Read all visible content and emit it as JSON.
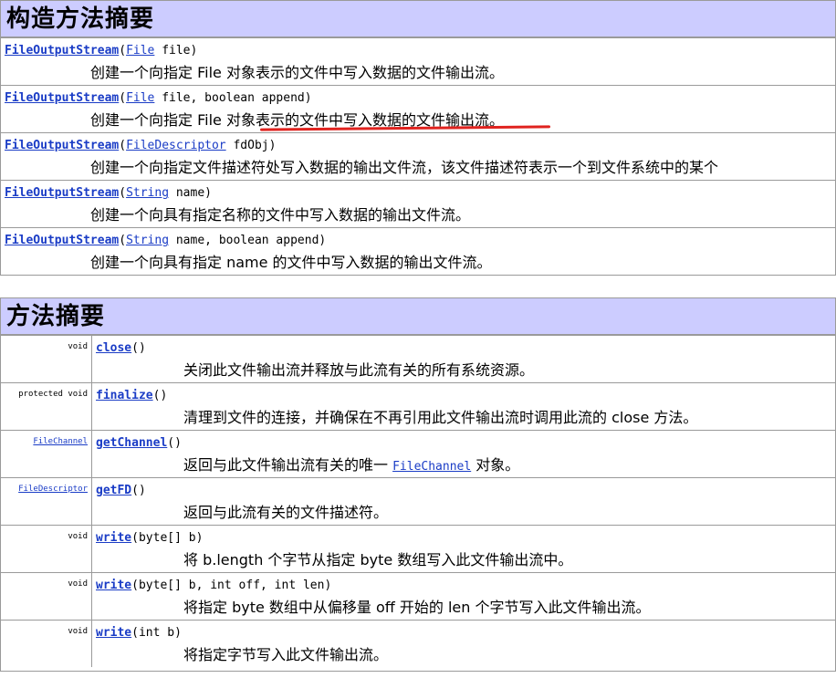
{
  "constructors": {
    "title": "构造方法摘要",
    "rows": [
      {
        "name": "FileOutputStream",
        "param_type": "File",
        "params_rest": " file)",
        "desc": "创建一个向指定 File 对象表示的文件中写入数据的文件输出流。"
      },
      {
        "name": "FileOutputStream",
        "param_type": "File",
        "params_rest": " file, boolean append)",
        "desc": "创建一个向指定 File 对象表示的文件中写入数据的文件输出流。"
      },
      {
        "name": "FileOutputStream",
        "param_type": "FileDescriptor",
        "params_rest": " fdObj)",
        "desc": "创建一个向指定文件描述符处写入数据的输出文件流，该文件描述符表示一个到文件系统中的某个"
      },
      {
        "name": "FileOutputStream",
        "param_type": "String",
        "params_rest": " name)",
        "desc": "创建一个向具有指定名称的文件中写入数据的输出文件流。"
      },
      {
        "name": "FileOutputStream",
        "param_type": "String",
        "params_rest": " name, boolean append)",
        "desc": "创建一个向具有指定 name 的文件中写入数据的输出文件流。"
      }
    ]
  },
  "methods": {
    "title": "方法摘要",
    "rows": [
      {
        "ret": "void",
        "name": "close",
        "params": "()",
        "desc": "关闭此文件输出流并释放与此流有关的所有系统资源。"
      },
      {
        "ret": "protected  void",
        "name": "finalize",
        "params": "()",
        "desc": "清理到文件的连接，并确保在不再引用此文件输出流时调用此流的 close 方法。"
      },
      {
        "ret": "FileChannel",
        "ret_link": true,
        "name": "getChannel",
        "params": "()",
        "desc_pre": "返回与此文件输出流有关的唯一 ",
        "desc_link": "FileChannel",
        "desc_post": " 对象。"
      },
      {
        "ret": "FileDescriptor",
        "ret_link": true,
        "name": "getFD",
        "params": "()",
        "desc": "返回与此流有关的文件描述符。"
      },
      {
        "ret": "void",
        "name": "write",
        "params": "(byte[] b)",
        "desc": "将 b.length 个字节从指定 byte 数组写入此文件输出流中。"
      },
      {
        "ret": "void",
        "name": "write",
        "params": "(byte[] b, int off, int len)",
        "desc": "将指定 byte 数组中从偏移量 off 开始的 len 个字节写入此文件输出流。"
      },
      {
        "ret": "void",
        "name": "write",
        "params": "(int b)",
        "desc": "将指定字节写入此文件输出流。"
      }
    ]
  },
  "colors": {
    "header_bg": "#ccccff",
    "link": "#1a3cc6",
    "annotation": "#e0231f"
  }
}
